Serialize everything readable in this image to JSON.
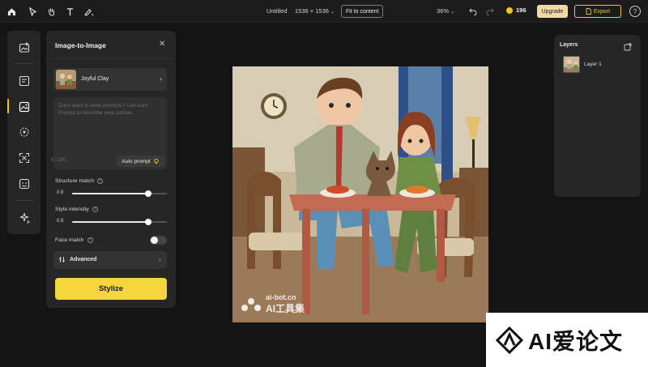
{
  "topbar": {
    "doc_title": "Untitled",
    "canvas_size": "1536 × 1536",
    "fit_label": "Fit to content",
    "zoom": "36%",
    "credits": "196",
    "upgrade_label": "Upgrade",
    "export_label": "Export",
    "help_label": "?"
  },
  "panel": {
    "title": "Image-to-Image",
    "close": "✕",
    "style_name": "Joyful Clay",
    "prompt_placeholder": "Don't want to write prompts? Use Auto Prompt to describe your canvas.",
    "prompt_count": "0 / 200",
    "auto_prompt_label": "Auto prompt",
    "structure_label": "Structure match",
    "structure_value": "0.8",
    "structure_level": 0.8,
    "style_label": "Style intensity",
    "style_value": "0.8",
    "style_level": 0.8,
    "face_label": "Face match",
    "face_enabled": false,
    "advanced_label": "Advanced",
    "stylize_label": "Stylize"
  },
  "canvas": {
    "watermark_line1": "ai-bot.cn",
    "watermark_line2": "AI工具集"
  },
  "layers": {
    "title": "Layers",
    "items": [
      {
        "name": "Layer 1"
      }
    ]
  },
  "badge": {
    "text": "AI爱论文"
  },
  "colors": {
    "accent": "#f5d53c",
    "background": "#141414",
    "panel": "#262626"
  }
}
